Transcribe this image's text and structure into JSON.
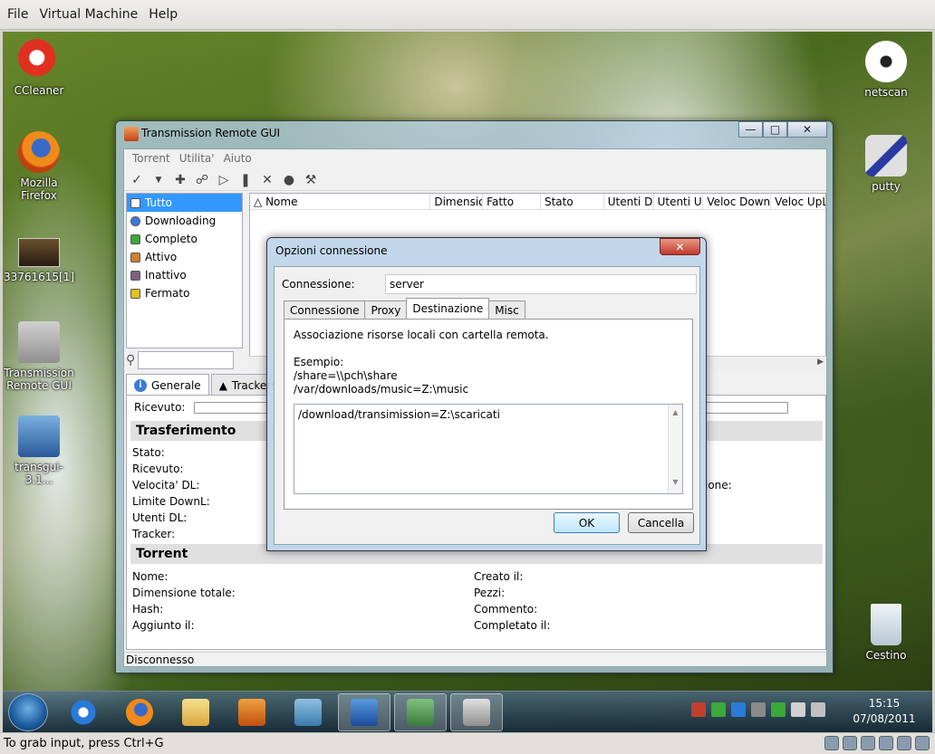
{
  "host": {
    "menu": [
      "File",
      "Virtual Machine",
      "Help"
    ],
    "status_text": "To grab input, press Ctrl+G"
  },
  "desktop_icons": {
    "ccleaner": "CCleaner",
    "firefox": "Mozilla Firefox",
    "image": "33761615[1]",
    "transmission": "Transmission Remote GUI",
    "transgui": "transgui-3.1...",
    "netscan": "netscan",
    "putty": "putty",
    "cestino": "Cestino"
  },
  "taskbar": {
    "time": "15:15",
    "date": "07/08/2011"
  },
  "main_window": {
    "title": "Transmission Remote GUI",
    "menu": [
      "Torrent",
      "Utilita'",
      "Aiuto"
    ],
    "filters": [
      "Tutto",
      "Downloading",
      "Completo",
      "Attivo",
      "Inattivo",
      "Fermato"
    ],
    "columns": [
      "Nome",
      "Dimensior",
      "Fatto",
      "Stato",
      "Utenti DL",
      "Utenti UP",
      "Veloc DownL",
      "Veloc UpL."
    ],
    "detail_tabs": [
      "Generale",
      "Trackers"
    ],
    "ricevuto_label": "Ricevuto:",
    "section_transfer": "Trasferimento",
    "transfer_fields": [
      "Stato:",
      "Ricevuto:",
      "Velocita' DL:",
      "Limite DownL:",
      "Utenti DL:",
      "Tracker:"
    ],
    "transfer_right_partial": "ione:",
    "section_torrent": "Torrent",
    "torrent_fields_left": [
      "Nome:",
      "Dimensione totale:",
      "Hash:",
      "Aggiunto il:"
    ],
    "torrent_fields_right": [
      "Creato il:",
      "Pezzi:",
      "Commento:",
      "Completato il:"
    ],
    "status": "Disconnesso"
  },
  "dialog": {
    "title": "Opzioni connessione",
    "connection_label": "Connessione:",
    "connection_value": "server",
    "tabs": [
      "Connessione",
      "Proxy",
      "Destinazione",
      "Misc"
    ],
    "description": "Associazione risorse locali con cartella remota.",
    "example_label": "Esempio:",
    "example_line1": "/share=\\\\pch\\share",
    "example_line2": "/var/downloads/music=Z:\\music",
    "mapping_value": "/download/transimission=Z:\\scaricati",
    "ok_label": "OK",
    "cancel_label": "Cancella"
  }
}
